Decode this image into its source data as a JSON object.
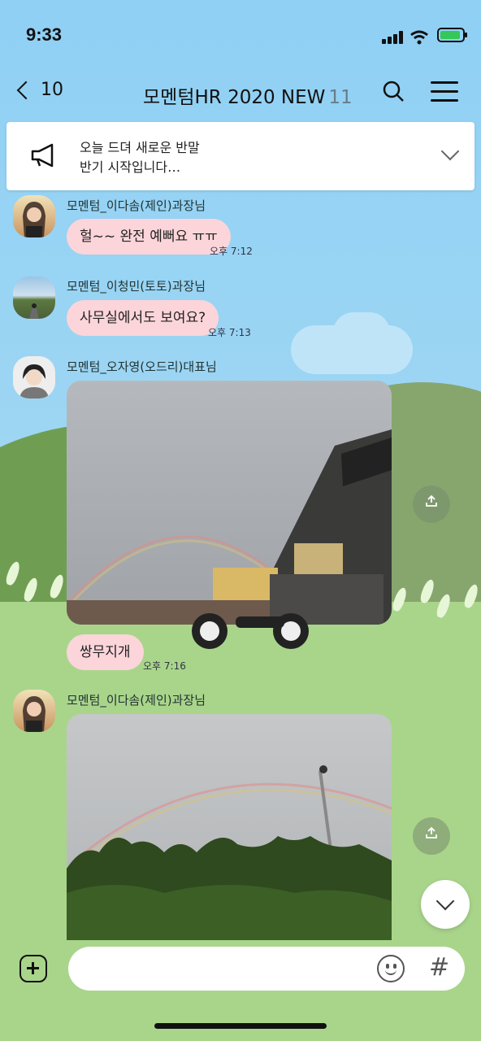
{
  "status_bar": {
    "time": "9:33"
  },
  "header": {
    "back_count": "10",
    "title": "모멘텀HR 2020 NEW",
    "member_count": "11"
  },
  "notice": {
    "line1": "오늘 드뎌 새로운 반말",
    "line2": "반기 시작입니다…"
  },
  "messages": [
    {
      "sender": "모멘텀_이다솜(제인)과장님",
      "text": "헐~~ 완전 예뻐요 ㅠㅠ",
      "time": "오후 7:12"
    },
    {
      "sender": "모멘텀_이청민(토토)과장님",
      "text": "사무실에서도 보여요?",
      "time": "오후 7:13"
    },
    {
      "sender": "모멘텀_오자영(오드리)대표님",
      "text": "쌍무지개",
      "time": "오후 7:16"
    },
    {
      "sender": "모멘텀_이다솜(제인)과장님"
    }
  ],
  "composer": {
    "placeholder": "",
    "hash_label": "#"
  },
  "colors": {
    "bubble": "#fbd5da",
    "sky": "#8fcdf0",
    "ground": "#a9d58b"
  }
}
